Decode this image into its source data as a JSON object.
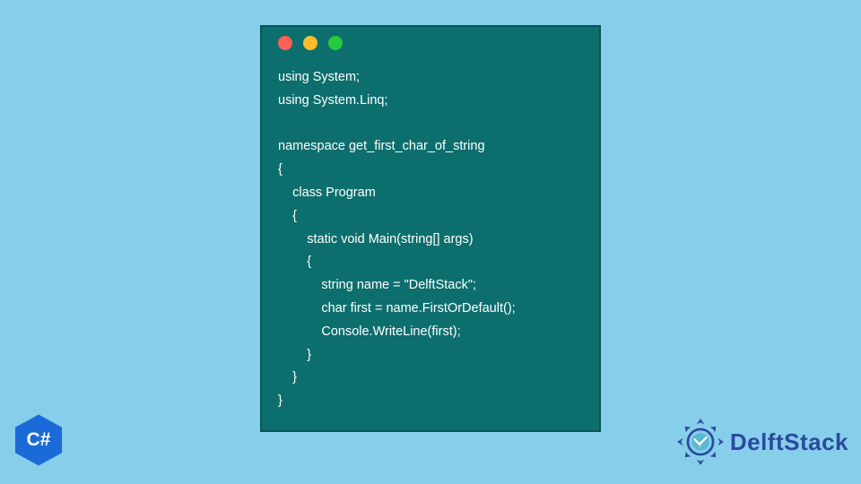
{
  "window": {
    "dots": {
      "red": "#ff5f56",
      "yellow": "#ffbd2e",
      "green": "#27c93f"
    }
  },
  "code": {
    "lines": [
      "using System;",
      "using System.Linq;",
      "",
      "namespace get_first_char_of_string",
      "{",
      "    class Program",
      "    {",
      "        static void Main(string[] args)",
      "        {",
      "            string name = \"DelftStack\";",
      "            char first = name.FirstOrDefault();",
      "            Console.WriteLine(first);",
      "        }",
      "    }",
      "}"
    ]
  },
  "badges": {
    "csharp_label": "C#",
    "delft_brand": "DelftStack"
  },
  "colors": {
    "page_bg": "#87ceeb",
    "window_bg": "#0d6e6e",
    "code_text": "#ffffff",
    "csharp_blue": "#1a6bd8",
    "delft_blue": "#2a4a9e"
  }
}
